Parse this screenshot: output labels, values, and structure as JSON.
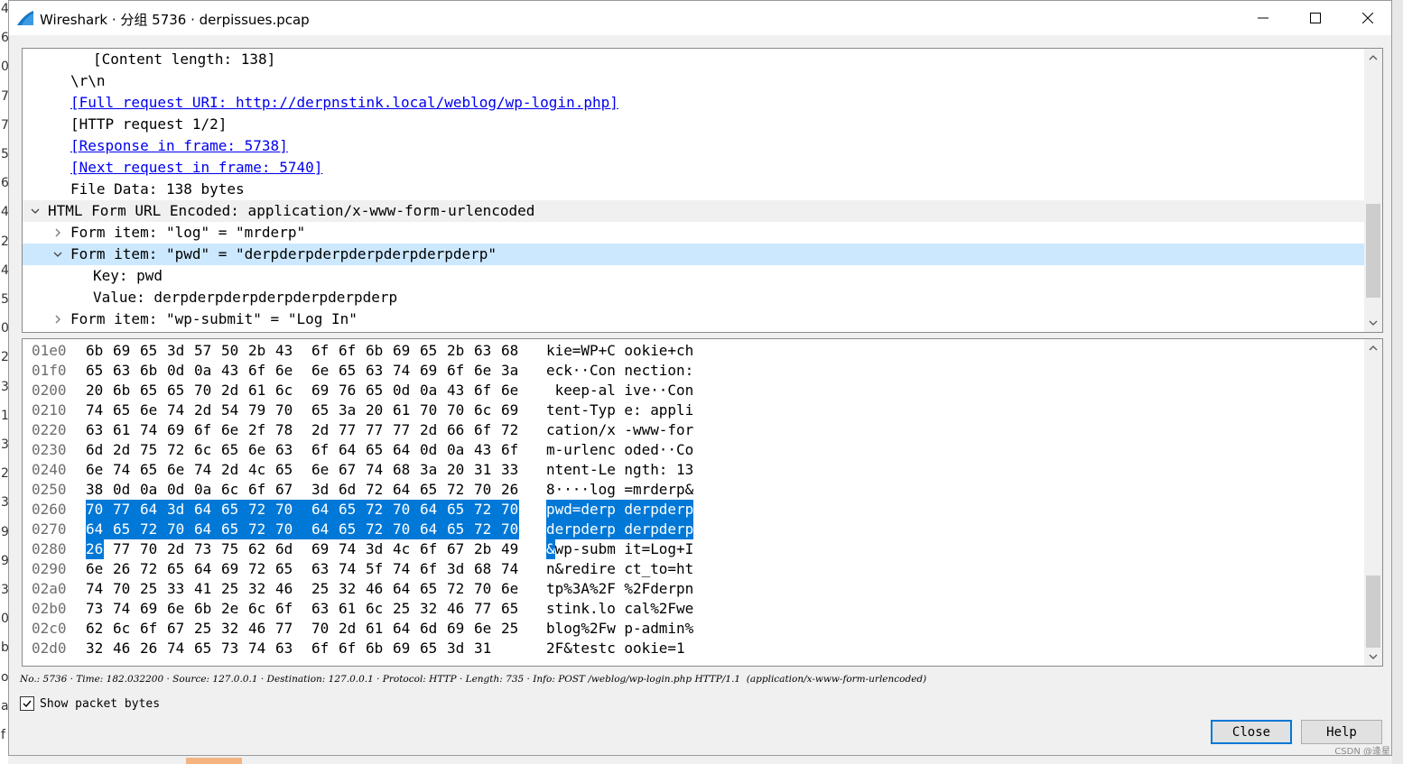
{
  "window": {
    "title": "Wireshark · 分组 5736 · derpissues.pcap"
  },
  "background_chars": [
    "4",
    "6",
    "0",
    "7",
    "7",
    "5",
    "6",
    "4",
    "2",
    "4",
    "5",
    "0",
    "2",
    "3",
    "1",
    "3",
    "2",
    "3",
    "9",
    "9",
    "3",
    "0",
    "b",
    "ot",
    "at",
    "f"
  ],
  "tree": [
    {
      "indent": 3,
      "chev": "",
      "text": "[Content length: 138]",
      "link": false,
      "sel": false,
      "hdr": false
    },
    {
      "indent": 2,
      "chev": "",
      "text": "\\r\\n",
      "link": false,
      "sel": false,
      "hdr": false
    },
    {
      "indent": 2,
      "chev": "",
      "text": "[Full request URI: http://derpnstink.local/weblog/wp-login.php]",
      "link": true,
      "sel": false,
      "hdr": false
    },
    {
      "indent": 2,
      "chev": "",
      "text": "[HTTP request 1/2]",
      "link": false,
      "sel": false,
      "hdr": false
    },
    {
      "indent": 2,
      "chev": "",
      "text": "[Response in frame: 5738]",
      "link": true,
      "sel": false,
      "hdr": false
    },
    {
      "indent": 2,
      "chev": "",
      "text": "[Next request in frame: 5740]",
      "link": true,
      "sel": false,
      "hdr": false
    },
    {
      "indent": 2,
      "chev": "",
      "text": "File Data: 138 bytes",
      "link": false,
      "sel": false,
      "hdr": false
    },
    {
      "indent": 1,
      "chev": "expanded",
      "text": "HTML Form URL Encoded: application/x-www-form-urlencoded",
      "link": false,
      "sel": false,
      "hdr": true
    },
    {
      "indent": 2,
      "chev": "collapsed",
      "text": "Form item: \"log\" = \"mrderp\"",
      "link": false,
      "sel": false,
      "hdr": false
    },
    {
      "indent": 2,
      "chev": "expanded",
      "text": "Form item: \"pwd\" = \"derpderpderpderpderpderpderp\"",
      "link": false,
      "sel": true,
      "hdr": false
    },
    {
      "indent": 3,
      "chev": "",
      "text": "Key: pwd",
      "link": false,
      "sel": false,
      "hdr": false
    },
    {
      "indent": 3,
      "chev": "",
      "text": "Value: derpderpderpderpderpderpderp",
      "link": false,
      "sel": false,
      "hdr": false
    },
    {
      "indent": 2,
      "chev": "collapsed",
      "text": "Form item: \"wp-submit\" = \"Log In\"",
      "link": false,
      "sel": false,
      "hdr": false
    }
  ],
  "hex": [
    {
      "offset": "01e0",
      "bytes": [
        "6b",
        "69",
        "65",
        "3d",
        "57",
        "50",
        "2b",
        "43",
        "6f",
        "6f",
        "6b",
        "69",
        "65",
        "2b",
        "63",
        "68"
      ],
      "ascii": "kie=WP+Cookie+ch",
      "hl": []
    },
    {
      "offset": "01f0",
      "bytes": [
        "65",
        "63",
        "6b",
        "0d",
        "0a",
        "43",
        "6f",
        "6e",
        "6e",
        "65",
        "63",
        "74",
        "69",
        "6f",
        "6e",
        "3a"
      ],
      "ascii": "eck··Connection:",
      "hl": []
    },
    {
      "offset": "0200",
      "bytes": [
        "20",
        "6b",
        "65",
        "65",
        "70",
        "2d",
        "61",
        "6c",
        "69",
        "76",
        "65",
        "0d",
        "0a",
        "43",
        "6f",
        "6e"
      ],
      "ascii": " keep-alive··Con",
      "hl": []
    },
    {
      "offset": "0210",
      "bytes": [
        "74",
        "65",
        "6e",
        "74",
        "2d",
        "54",
        "79",
        "70",
        "65",
        "3a",
        "20",
        "61",
        "70",
        "70",
        "6c",
        "69"
      ],
      "ascii": "tent-Type: appli",
      "hl": []
    },
    {
      "offset": "0220",
      "bytes": [
        "63",
        "61",
        "74",
        "69",
        "6f",
        "6e",
        "2f",
        "78",
        "2d",
        "77",
        "77",
        "77",
        "2d",
        "66",
        "6f",
        "72"
      ],
      "ascii": "cation/x-www-for",
      "hl": []
    },
    {
      "offset": "0230",
      "bytes": [
        "6d",
        "2d",
        "75",
        "72",
        "6c",
        "65",
        "6e",
        "63",
        "6f",
        "64",
        "65",
        "64",
        "0d",
        "0a",
        "43",
        "6f"
      ],
      "ascii": "m-urlencoded··Co",
      "hl": []
    },
    {
      "offset": "0240",
      "bytes": [
        "6e",
        "74",
        "65",
        "6e",
        "74",
        "2d",
        "4c",
        "65",
        "6e",
        "67",
        "74",
        "68",
        "3a",
        "20",
        "31",
        "33"
      ],
      "ascii": "ntent-Length: 13",
      "hl": []
    },
    {
      "offset": "0250",
      "bytes": [
        "38",
        "0d",
        "0a",
        "0d",
        "0a",
        "6c",
        "6f",
        "67",
        "3d",
        "6d",
        "72",
        "64",
        "65",
        "72",
        "70",
        "26"
      ],
      "ascii": "8····log=mrderp&",
      "hl": []
    },
    {
      "offset": "0260",
      "bytes": [
        "70",
        "77",
        "64",
        "3d",
        "64",
        "65",
        "72",
        "70",
        "64",
        "65",
        "72",
        "70",
        "64",
        "65",
        "72",
        "70"
      ],
      "ascii": "pwd=derpderpderp",
      "hl": [
        0,
        1,
        2,
        3,
        4,
        5,
        6,
        7,
        8,
        9,
        10,
        11,
        12,
        13,
        14,
        15
      ]
    },
    {
      "offset": "0270",
      "bytes": [
        "64",
        "65",
        "72",
        "70",
        "64",
        "65",
        "72",
        "70",
        "64",
        "65",
        "72",
        "70",
        "64",
        "65",
        "72",
        "70"
      ],
      "ascii": "derpderpderpderp",
      "hl": [
        0,
        1,
        2,
        3,
        4,
        5,
        6,
        7,
        8,
        9,
        10,
        11,
        12,
        13,
        14,
        15
      ]
    },
    {
      "offset": "0280",
      "bytes": [
        "26",
        "77",
        "70",
        "2d",
        "73",
        "75",
        "62",
        "6d",
        "69",
        "74",
        "3d",
        "4c",
        "6f",
        "67",
        "2b",
        "49"
      ],
      "ascii": "&wp-submit=Log+I",
      "hl": [
        0
      ]
    },
    {
      "offset": "0290",
      "bytes": [
        "6e",
        "26",
        "72",
        "65",
        "64",
        "69",
        "72",
        "65",
        "63",
        "74",
        "5f",
        "74",
        "6f",
        "3d",
        "68",
        "74"
      ],
      "ascii": "n&redirect_to=ht",
      "hl": []
    },
    {
      "offset": "02a0",
      "bytes": [
        "74",
        "70",
        "25",
        "33",
        "41",
        "25",
        "32",
        "46",
        "25",
        "32",
        "46",
        "64",
        "65",
        "72",
        "70",
        "6e"
      ],
      "ascii": "tp%3A%2F%2Fderpn",
      "hl": []
    },
    {
      "offset": "02b0",
      "bytes": [
        "73",
        "74",
        "69",
        "6e",
        "6b",
        "2e",
        "6c",
        "6f",
        "63",
        "61",
        "6c",
        "25",
        "32",
        "46",
        "77",
        "65"
      ],
      "ascii": "stink.local%2Fwe",
      "hl": []
    },
    {
      "offset": "02c0",
      "bytes": [
        "62",
        "6c",
        "6f",
        "67",
        "25",
        "32",
        "46",
        "77",
        "70",
        "2d",
        "61",
        "64",
        "6d",
        "69",
        "6e",
        "25"
      ],
      "ascii": "blog%2Fwp-admin%",
      "hl": []
    },
    {
      "offset": "02d0",
      "bytes": [
        "32",
        "46",
        "26",
        "74",
        "65",
        "73",
        "74",
        "63",
        "6f",
        "6f",
        "6b",
        "69",
        "65",
        "3d",
        "31"
      ],
      "ascii": "2F&testcookie=1",
      "hl": []
    }
  ],
  "status_line": "No.: 5736 · Time: 182.032200 · Source: 127.0.0.1 · Destination: 127.0.0.1 · Protocol: HTTP · Length: 735 · Info: POST /weblog/wp-login.php HTTP/1.1  (application/x-www-form-urlencoded)",
  "show_bytes": {
    "label": "Show packet bytes",
    "checked": true
  },
  "buttons": {
    "close": "Close",
    "help": "Help"
  },
  "watermark": "CSDN @逄星",
  "colors": {
    "selection": "#0078d7",
    "tree_selection": "#cce8ff",
    "link": "#0000ee"
  }
}
